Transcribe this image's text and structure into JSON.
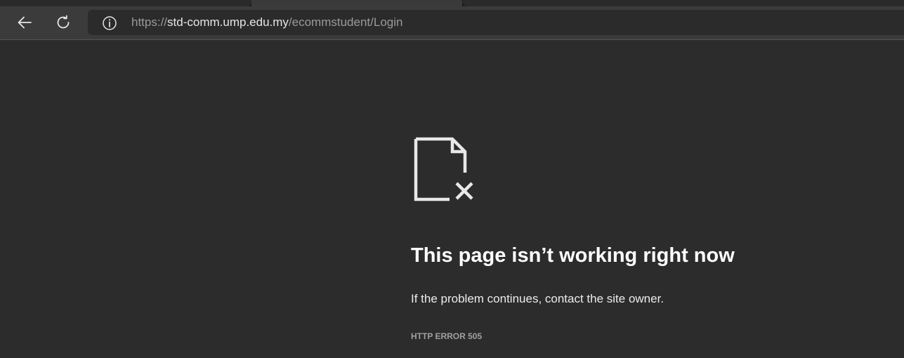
{
  "browser": {
    "address_bar": {
      "url_scheme": "https://",
      "url_host": "std-comm.ump.edu.my",
      "url_path": "/ecommstudent/Login"
    },
    "icons": {
      "back": "back-arrow-icon",
      "refresh": "refresh-icon",
      "site_info": "info-icon"
    }
  },
  "error_page": {
    "icon": "broken-page-icon",
    "title": "This page isn’t working right now",
    "description": "If the problem continues, contact the site owner.",
    "error_code": "HTTP ERROR 505"
  },
  "colors": {
    "page_background": "#2c2c2c",
    "toolbar_background": "#3b3b3b",
    "text_primary": "#ffffff"
  }
}
